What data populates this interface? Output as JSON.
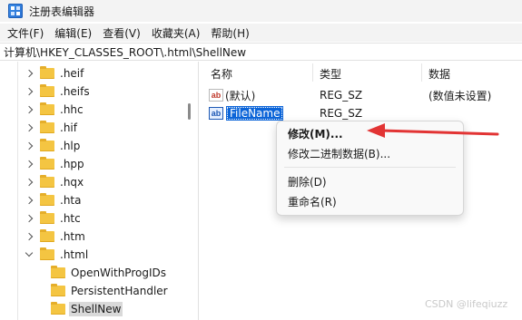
{
  "window": {
    "title": "注册表编辑器"
  },
  "menu": [
    "文件(F)",
    "编辑(E)",
    "查看(V)",
    "收藏夹(A)",
    "帮助(H)"
  ],
  "address": {
    "path": "计算机\\HKEY_CLASSES_ROOT\\.html\\ShellNew"
  },
  "tree": {
    "items": [
      {
        "label": ".heif",
        "chevron": "right"
      },
      {
        "label": ".heifs",
        "chevron": "right"
      },
      {
        "label": ".hhc",
        "chevron": "right"
      },
      {
        "label": ".hif",
        "chevron": "right"
      },
      {
        "label": ".hlp",
        "chevron": "right"
      },
      {
        "label": ".hpp",
        "chevron": "right"
      },
      {
        "label": ".hqx",
        "chevron": "right"
      },
      {
        "label": ".hta",
        "chevron": "right"
      },
      {
        "label": ".htc",
        "chevron": "right"
      },
      {
        "label": ".htm",
        "chevron": "right"
      },
      {
        "label": ".html",
        "chevron": "down"
      },
      {
        "label": "OpenWithProgIDs",
        "chevron": "none"
      },
      {
        "label": "PersistentHandler",
        "chevron": "none"
      },
      {
        "label": "ShellNew",
        "chevron": "none",
        "selected": true
      }
    ]
  },
  "list": {
    "columns": [
      "名称",
      "类型",
      "数据"
    ],
    "rows": [
      {
        "name": "(默认)",
        "type": "REG_SZ",
        "data": "(数值未设置)"
      },
      {
        "name": "FileName",
        "type": "REG_SZ",
        "data": ""
      }
    ]
  },
  "context_menu": {
    "items": [
      "修改(M)...",
      "修改二进制数据(B)...",
      "删除(D)",
      "重命名(R)"
    ]
  },
  "watermark": "CSDN @lifeqiuzz",
  "colors": {
    "selection": "#0b64d8",
    "arrow": "#e23434",
    "folder": "#f4c542"
  }
}
